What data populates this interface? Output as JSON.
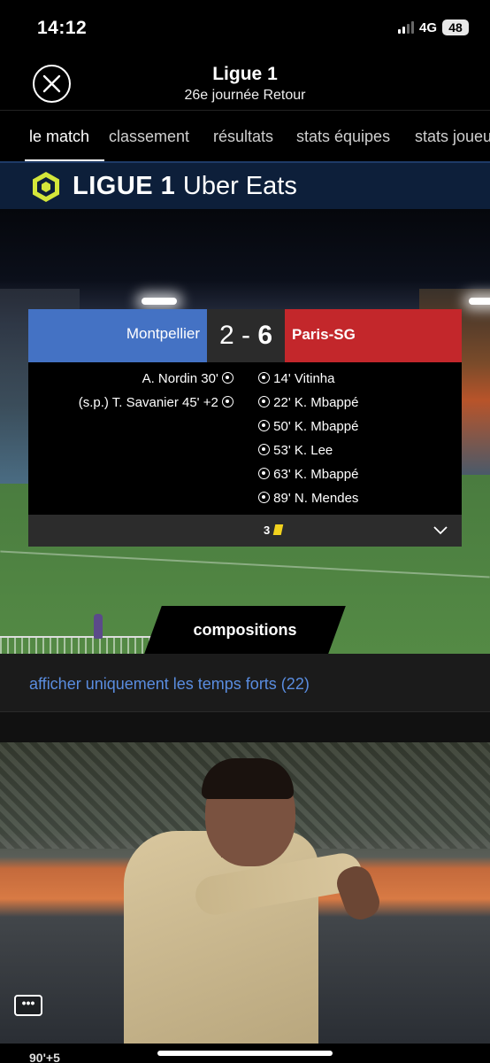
{
  "status_bar": {
    "time": "14:12",
    "network": "4G",
    "battery": "48"
  },
  "header": {
    "title": "Ligue 1",
    "subtitle": "26e journée Retour"
  },
  "tabs": [
    {
      "label": "le match",
      "active": true
    },
    {
      "label": "classement",
      "active": false
    },
    {
      "label": "résultats",
      "active": false
    },
    {
      "label": "stats équipes",
      "active": false
    },
    {
      "label": "stats joueurs",
      "active": false
    }
  ],
  "banner": {
    "brand": "LIGUE 1",
    "sponsor": "Uber Eats"
  },
  "match": {
    "home_team": "Montpellier",
    "away_team": "Paris-SG",
    "home_score": "2",
    "separator": "-",
    "away_score": "6",
    "home_goals": [
      {
        "text": "A. Nordin  30'"
      },
      {
        "text": "(s.p.)  T. Savanier  45' +2"
      }
    ],
    "away_goals": [
      {
        "text": "14'  Vitinha"
      },
      {
        "text": "22'  K. Mbappé"
      },
      {
        "text": "50'  K. Mbappé"
      },
      {
        "text": "53'  K. Lee"
      },
      {
        "text": "63'  K. Mbappé"
      },
      {
        "text": "89'  N. Mendes"
      }
    ],
    "yellow_cards": "3"
  },
  "compositions_label": "compositions",
  "highlights_link": "afficher uniquement les temps forts (22)",
  "chat_icon_label": "•••",
  "feed_minute": "90'+5",
  "colors": {
    "home": "#4472c4",
    "away": "#c3272b",
    "link": "#5a8de0",
    "yellow_card": "#f2d21e"
  }
}
